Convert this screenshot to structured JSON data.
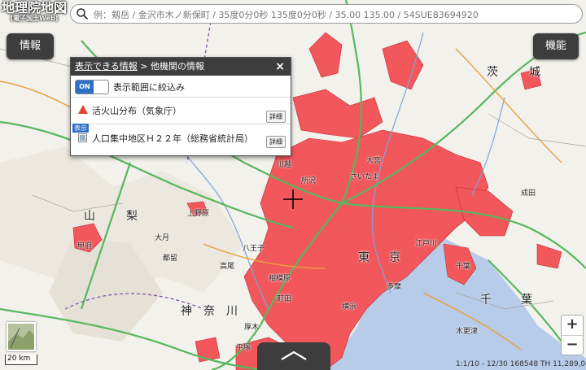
{
  "app": {
    "logo_title": "地理院地図",
    "logo_sub": "(電子国土Web)"
  },
  "search": {
    "placeholder": "例：剱岳 / 金沢市木ノ新保町 / 35度0分0秒 135度0分0秒 / 35.00 135.00 / 54SUE83694920"
  },
  "buttons": {
    "info": "情報",
    "features": "機能"
  },
  "panel": {
    "breadcrumb_link": "表示できる情報",
    "breadcrumb_sep": " > ",
    "breadcrumb_current": "他機関の情報",
    "close": "×",
    "toggle_on": "ON",
    "toggle_label": "表示範囲に絞込み",
    "items": [
      {
        "label": "活火山分布（気象庁）",
        "detail": "詳細",
        "badge": ""
      },
      {
        "label": "人口集中地区Ｈ２２年（総務省統計局）",
        "detail": "詳細",
        "badge": "表示"
      }
    ]
  },
  "map": {
    "region_labels": [
      "山",
      "梨",
      "茨",
      "城",
      "神",
      "奈",
      "川",
      "千",
      "葉",
      "東",
      "京"
    ],
    "place_labels": [
      "甲府",
      "八王子",
      "高尾",
      "上野原",
      "大月",
      "都留",
      "町田",
      "厚木",
      "平塚",
      "相模原",
      "多摩",
      "さいたま",
      "江戸川",
      "大宮",
      "所沢",
      "川越",
      "成田",
      "木更津",
      "横浜",
      "千葉"
    ],
    "scale": "20 km",
    "coords": "1:1/10 - 12/30 168548 TH 11,289,047"
  },
  "controls": {
    "zoom_in": "+",
    "zoom_out": "−"
  },
  "colors": {
    "did_fill": "#f2575c",
    "road_green": "#55b85c",
    "road_orange": "#e8a03a",
    "sea": "#b7cce9",
    "panel_header": "#3d3d3d",
    "toggle_on": "#2e6fc7"
  }
}
